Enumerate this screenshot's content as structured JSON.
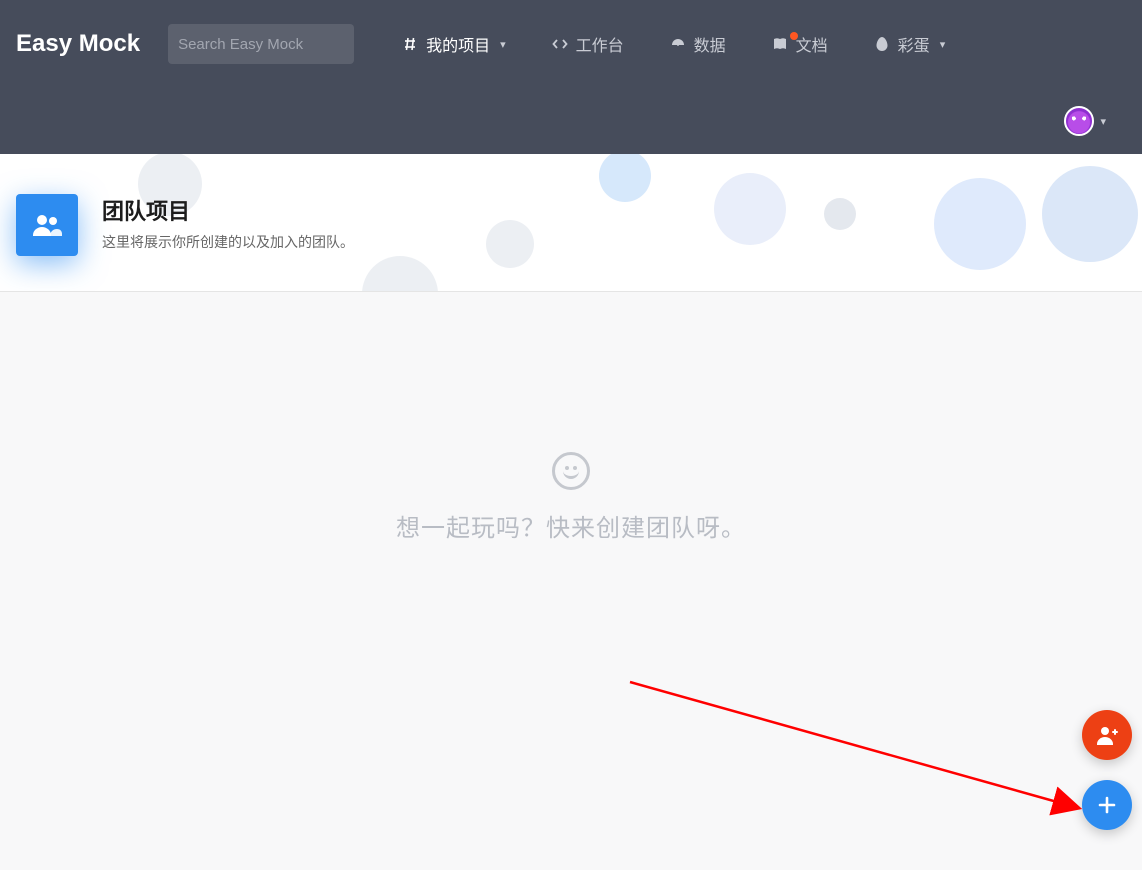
{
  "logo": "Easy Mock",
  "search": {
    "placeholder": "Search Easy Mock"
  },
  "nav": {
    "projects": "我的项目",
    "workbench": "工作台",
    "data": "数据",
    "docs": "文档",
    "egg": "彩蛋"
  },
  "page": {
    "title": "团队项目",
    "subtitle": "这里将展示你所创建的以及加入的团队。"
  },
  "empty": {
    "message": "想一起玩吗？快来创建团队呀。"
  }
}
